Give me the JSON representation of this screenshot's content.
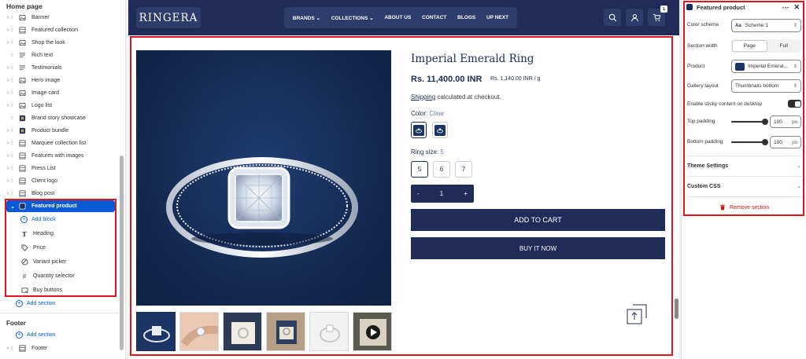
{
  "sidebar": {
    "title": "Home page",
    "items": [
      {
        "label": "Banner",
        "icon": "image-icon"
      },
      {
        "label": "Featured collection",
        "icon": "grid-icon"
      },
      {
        "label": "Shop the look",
        "icon": "image-icon"
      },
      {
        "label": "Rich text",
        "icon": "text-icon"
      },
      {
        "label": "Testimonials",
        "icon": "text-icon"
      },
      {
        "label": "Hero image",
        "icon": "image-icon"
      },
      {
        "label": "Image card",
        "icon": "image-icon"
      },
      {
        "label": "Logo list",
        "icon": "image-icon"
      },
      {
        "label": "Brand story showcase",
        "icon": "app-icon"
      },
      {
        "label": "Product bundle",
        "icon": "app-icon"
      },
      {
        "label": "Marquee collection list",
        "icon": "grid-icon"
      },
      {
        "label": "Features with images",
        "icon": "grid-icon"
      },
      {
        "label": "Press List",
        "icon": "grid-icon"
      },
      {
        "label": "Client logo",
        "icon": "grid-icon"
      },
      {
        "label": "Blog post",
        "icon": "grid-icon"
      }
    ],
    "selected": {
      "label": "Featured product"
    },
    "blocks": [
      {
        "label": "Add block",
        "icon": "plus-circle-icon"
      },
      {
        "label": "Heading",
        "icon": "heading-icon"
      },
      {
        "label": "Price",
        "icon": "price-tag-icon"
      },
      {
        "label": "Variant picker",
        "icon": "variant-icon"
      },
      {
        "label": "Quantity selector",
        "icon": "hash-icon"
      },
      {
        "label": "Buy buttons",
        "icon": "buy-icon"
      }
    ],
    "add_section": "Add section",
    "footer_title": "Footer",
    "footer_add_section": "Add section",
    "footer_item": "Footer"
  },
  "store": {
    "logo": "RINGERA",
    "nav": [
      "BRANDS",
      "COLLECTIONS",
      "ABOUT US",
      "CONTACT",
      "BLOGS",
      "UP NEXT"
    ],
    "cart_count": "1"
  },
  "product": {
    "title": "Imperial Emerald Ring",
    "price": "Rs. 11,400.00 INR",
    "unit_price": "Rs. 1,140.00 INR / g",
    "shipping_link": "Shipping",
    "shipping_text": " calculated at checkout.",
    "color_label": "Color:",
    "color_value": "Clear",
    "size_label": "Ring size:",
    "size_value": "5",
    "sizes": [
      "5",
      "6",
      "7"
    ],
    "qty_minus": "-",
    "qty_value": "1",
    "qty_plus": "+",
    "add_to_cart": "ADD TO CART",
    "buy_now": "BUY IT NOW"
  },
  "settings": {
    "title": "Featured product",
    "color_scheme_label": "Color scheme",
    "color_scheme_value": "Scheme 1",
    "section_width_label": "Section width",
    "width_options": [
      "Page",
      "Full"
    ],
    "product_label": "Product",
    "product_value": "Imperial Emeral...",
    "gallery_label": "Gallery layout",
    "gallery_value": "Thumbnails bottom",
    "sticky_label": "Enable sticky content on desktop",
    "top_padding_label": "Top padding",
    "top_padding_value": "100",
    "bottom_padding_label": "Bottom padding",
    "bottom_padding_value": "100",
    "unit": "px",
    "theme_settings": "Theme Settings",
    "custom_css": "Custom CSS",
    "remove": "Remove section"
  },
  "colors": {
    "navy": "#1e2c57",
    "select_blue": "#0a5ad6",
    "highlight_red": "#e0141d"
  }
}
